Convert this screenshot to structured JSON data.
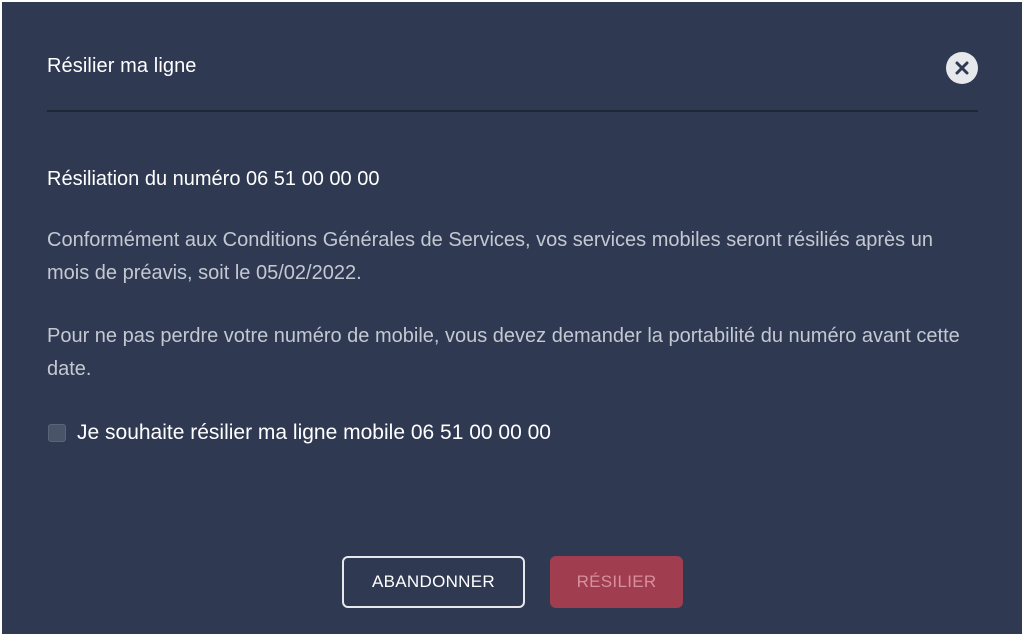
{
  "dialog": {
    "title": "Résilier ma ligne",
    "close_icon": "close-icon"
  },
  "content": {
    "subtitle_prefix": "Résiliation du numéro 06 51",
    "subtitle_number_tail": "00 00 00",
    "paragraph_1": "Conformément aux Conditions Générales de Services, vos services mobiles seront résiliés après un mois de préavis, soit le 05/02/2022.",
    "paragraph_2": "Pour ne pas perdre votre numéro de mobile, vous devez demander la portabilité du numéro avant cette date.",
    "checkbox": {
      "label_prefix": "Je souhaite résilier ma ligne mobile 06 51",
      "label_number_tail": "00 00 00",
      "checked": false
    }
  },
  "actions": {
    "abandon_label": "ABANDONNER",
    "resilier_label": "RÉSILIER",
    "resilier_disabled": true
  },
  "colors": {
    "background": "#2f3a52",
    "primary_disabled": "#a03d4e",
    "muted_text": "#c3c8d2"
  }
}
